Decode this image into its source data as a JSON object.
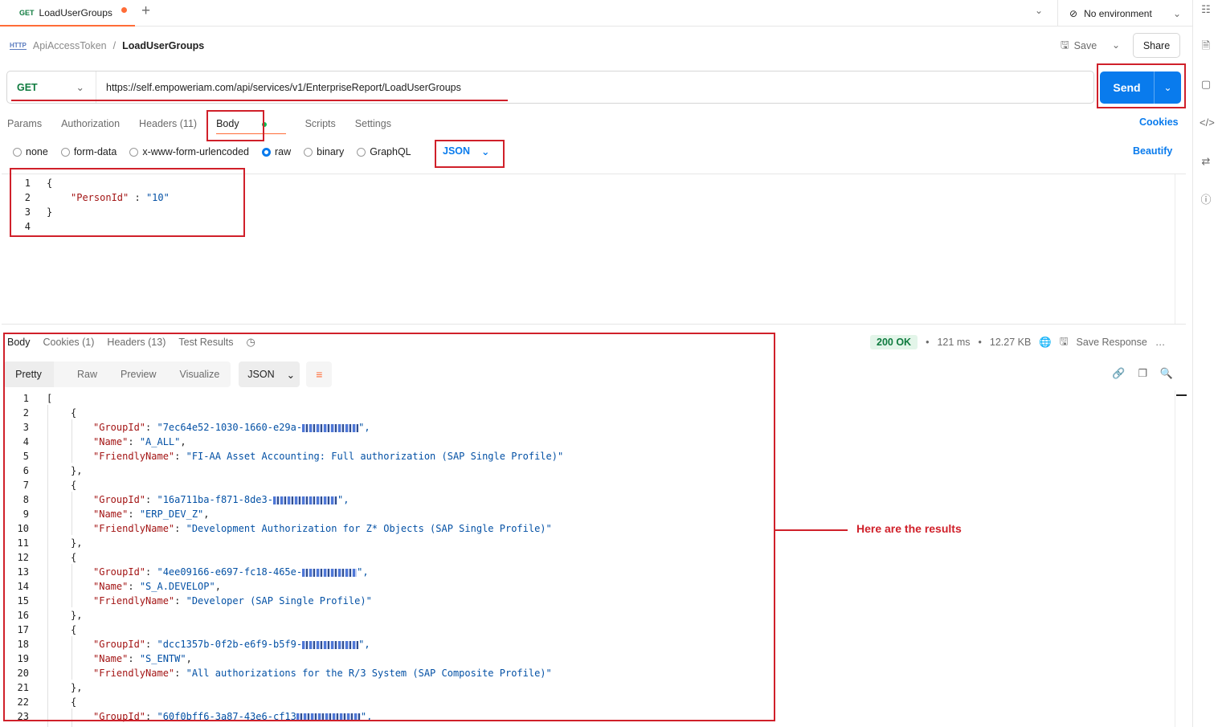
{
  "tab": {
    "method": "GET",
    "title": "LoadUserGroups"
  },
  "environment": {
    "label": "No environment"
  },
  "breadcrumb": {
    "parent": "ApiAccessToken",
    "separator": "/",
    "current": "LoadUserGroups"
  },
  "toolbar": {
    "save_label": "Save",
    "share_label": "Share"
  },
  "request": {
    "method": "GET",
    "url": "https://self.empoweriam.com/api/services/v1/EnterpriseReport/LoadUserGroups",
    "send_label": "Send"
  },
  "request_tabs": [
    "Params",
    "Authorization",
    "Headers (11)",
    "Body",
    "Scripts",
    "Settings"
  ],
  "cookies_label": "Cookies",
  "body_types": [
    "none",
    "form-data",
    "x-www-form-urlencoded",
    "raw",
    "binary",
    "GraphQL"
  ],
  "selected_body_type": "raw",
  "body_language": "JSON",
  "beautify_label": "Beautify",
  "request_body": {
    "line_numbers": [
      "1",
      "2",
      "3",
      "4"
    ],
    "open": "{",
    "key": "\"PersonId\"",
    "colon": " : ",
    "value": "\"10\"",
    "close": "}"
  },
  "response_tabs": [
    "Body",
    "Cookies (1)",
    "Headers (13)",
    "Test Results"
  ],
  "response_status": {
    "code": "200 OK",
    "time": "121 ms",
    "size": "12.27 KB",
    "save_label": "Save Response"
  },
  "view_modes": [
    "Pretty",
    "Raw",
    "Preview",
    "Visualize"
  ],
  "response_language": "JSON",
  "response_body": {
    "line_numbers": [
      "1",
      "2",
      "3",
      "4",
      "5",
      "6",
      "7",
      "8",
      "9",
      "10",
      "11",
      "12",
      "13",
      "14",
      "15",
      "16",
      "17",
      "18",
      "19",
      "20",
      "21",
      "22",
      "23"
    ],
    "groups": [
      {
        "group_id": "\"7ec64e52-1030-1660-e29a-",
        "name": "\"A_ALL\"",
        "friendly_name": "\"FI-AA Asset Accounting: Full authorization (SAP Single Profile)\""
      },
      {
        "group_id": "\"16a711ba-f871-8de3-",
        "name": "\"ERP_DEV_Z\"",
        "friendly_name": "\"Development Authorization for Z* Objects (SAP Single Profile)\""
      },
      {
        "group_id": "\"4ee09166-e697-fc18-465e-",
        "name": "\"S_A.DEVELOP\"",
        "friendly_name": "\"Developer (SAP Single Profile)\""
      },
      {
        "group_id": "\"dcc1357b-0f2b-e6f9-b5f9-",
        "name": "\"S_ENTW\"",
        "friendly_name": "\"All authorizations for the R/3 System (SAP Composite Profile)\""
      },
      {
        "group_id": "\"60f0bff6-3a87-43e6-cf13"
      }
    ],
    "keys": {
      "group_id": "\"GroupId\"",
      "name": "\"Name\"",
      "friendly_name": "\"FriendlyName\""
    }
  },
  "annotation": "Here are the results"
}
